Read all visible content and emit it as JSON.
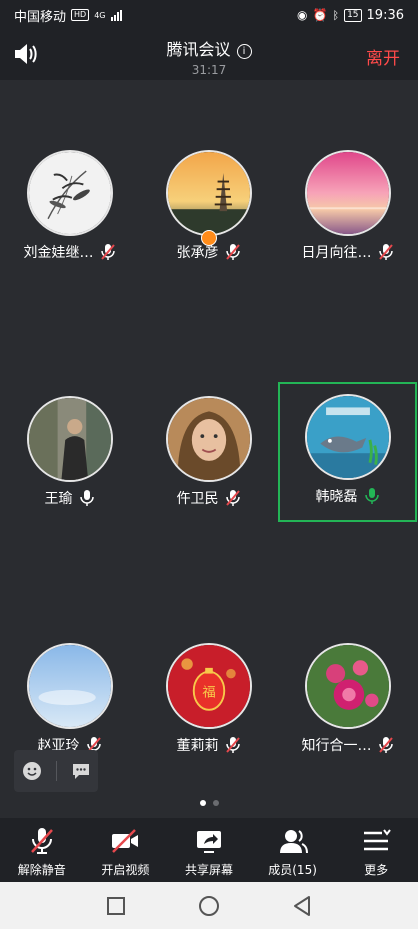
{
  "status_bar": {
    "carrier": "中国移动",
    "hd": "HD",
    "network": "4G",
    "battery": "15",
    "time": "19:36"
  },
  "header": {
    "title": "腾讯会议",
    "timer": "31:17",
    "leave_label": "离开"
  },
  "participants": [
    {
      "name": "刘金娃继…",
      "mic": "muted",
      "avatar": "ink-bamboo"
    },
    {
      "name": "张承彦",
      "mic": "muted",
      "avatar": "pagoda-sunset",
      "host": true
    },
    {
      "name": "日月向往…",
      "mic": "muted",
      "avatar": "pink-sunset"
    },
    {
      "name": "王瑜",
      "mic": "on",
      "avatar": "man-outdoor"
    },
    {
      "name": "仵卫民",
      "mic": "muted",
      "avatar": "woman-portrait"
    },
    {
      "name": "韩晓磊",
      "mic": "speaking",
      "avatar": "shark-cartoon",
      "active": true
    },
    {
      "name": "赵亚玲",
      "mic": "muted",
      "avatar": "blue-sky"
    },
    {
      "name": "董莉莉",
      "mic": "muted",
      "avatar": "red-lantern"
    },
    {
      "name": "知行合一…",
      "mic": "muted",
      "avatar": "pink-flower"
    }
  ],
  "toolbar": {
    "unmute_label": "解除静音",
    "video_label": "开启视频",
    "share_label": "共享屏幕",
    "members_label": "成员(15)",
    "more_label": "更多"
  },
  "pages": {
    "current": 1,
    "total": 2
  },
  "colors": {
    "accent_green": "#23b556",
    "leave_red": "#ff4a4a",
    "muted_red": "#e5484d"
  }
}
